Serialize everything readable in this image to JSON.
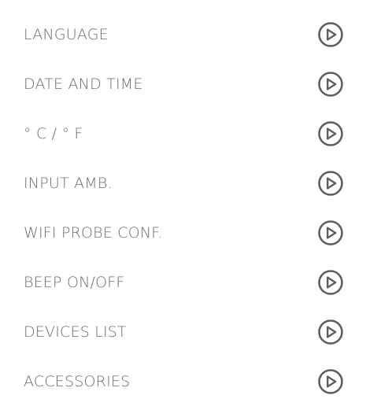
{
  "menu": {
    "items": [
      {
        "label": "LANGUAGE",
        "icon": "play-circle-icon"
      },
      {
        "label": "DATE AND TIME",
        "icon": "play-circle-icon"
      },
      {
        "label": "° C / ° F",
        "icon": "play-circle-icon"
      },
      {
        "label": "INPUT AMB.",
        "icon": "play-circle-icon"
      },
      {
        "label": "WIFI PROBE CONF.",
        "icon": "play-circle-icon"
      },
      {
        "label": "BEEP ON/OFF",
        "icon": "play-circle-icon"
      },
      {
        "label": "DEVICES LIST",
        "icon": "play-circle-icon"
      },
      {
        "label": "ACCESSORIES",
        "icon": "play-circle-icon"
      }
    ]
  },
  "colors": {
    "background": "#ffffff",
    "label_text": "#6d6d6d",
    "icon_stroke": "#5f5f5f"
  }
}
